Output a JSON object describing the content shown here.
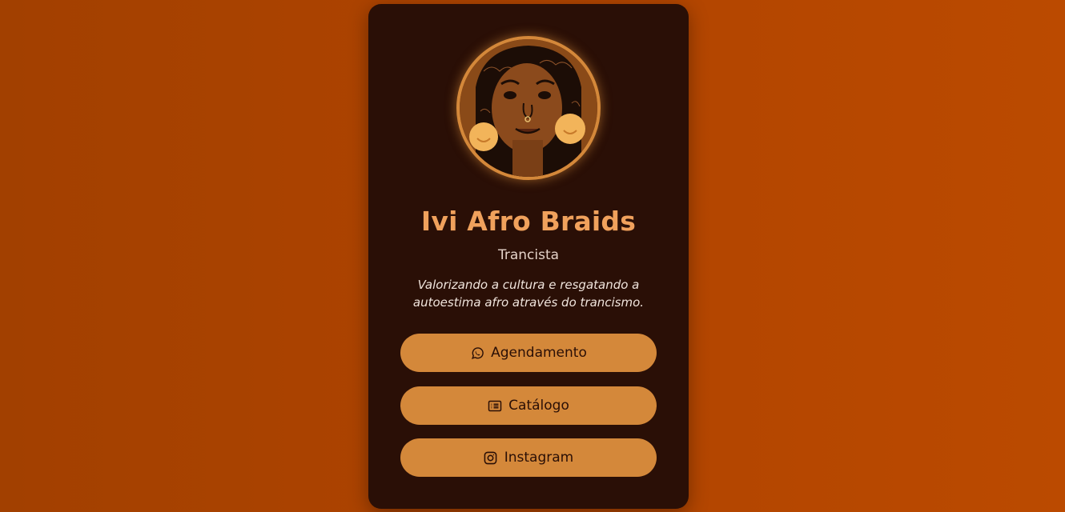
{
  "profile": {
    "name": "Ivi Afro Braids",
    "role": "Trancista",
    "bio": "Valorizando a cultura e resgatando a autoestima afro através do trancismo.",
    "avatar_icon": "illustrated-woman-braids-avatar"
  },
  "links": [
    {
      "label": "Agendamento",
      "icon": "whatsapp-icon"
    },
    {
      "label": "Catálogo",
      "icon": "list-icon"
    },
    {
      "label": "Instagram",
      "icon": "instagram-icon"
    }
  ],
  "colors": {
    "background": "#b04400",
    "card": "#2a0f06",
    "accent": "#d4883a",
    "title": "#f0a15c"
  }
}
